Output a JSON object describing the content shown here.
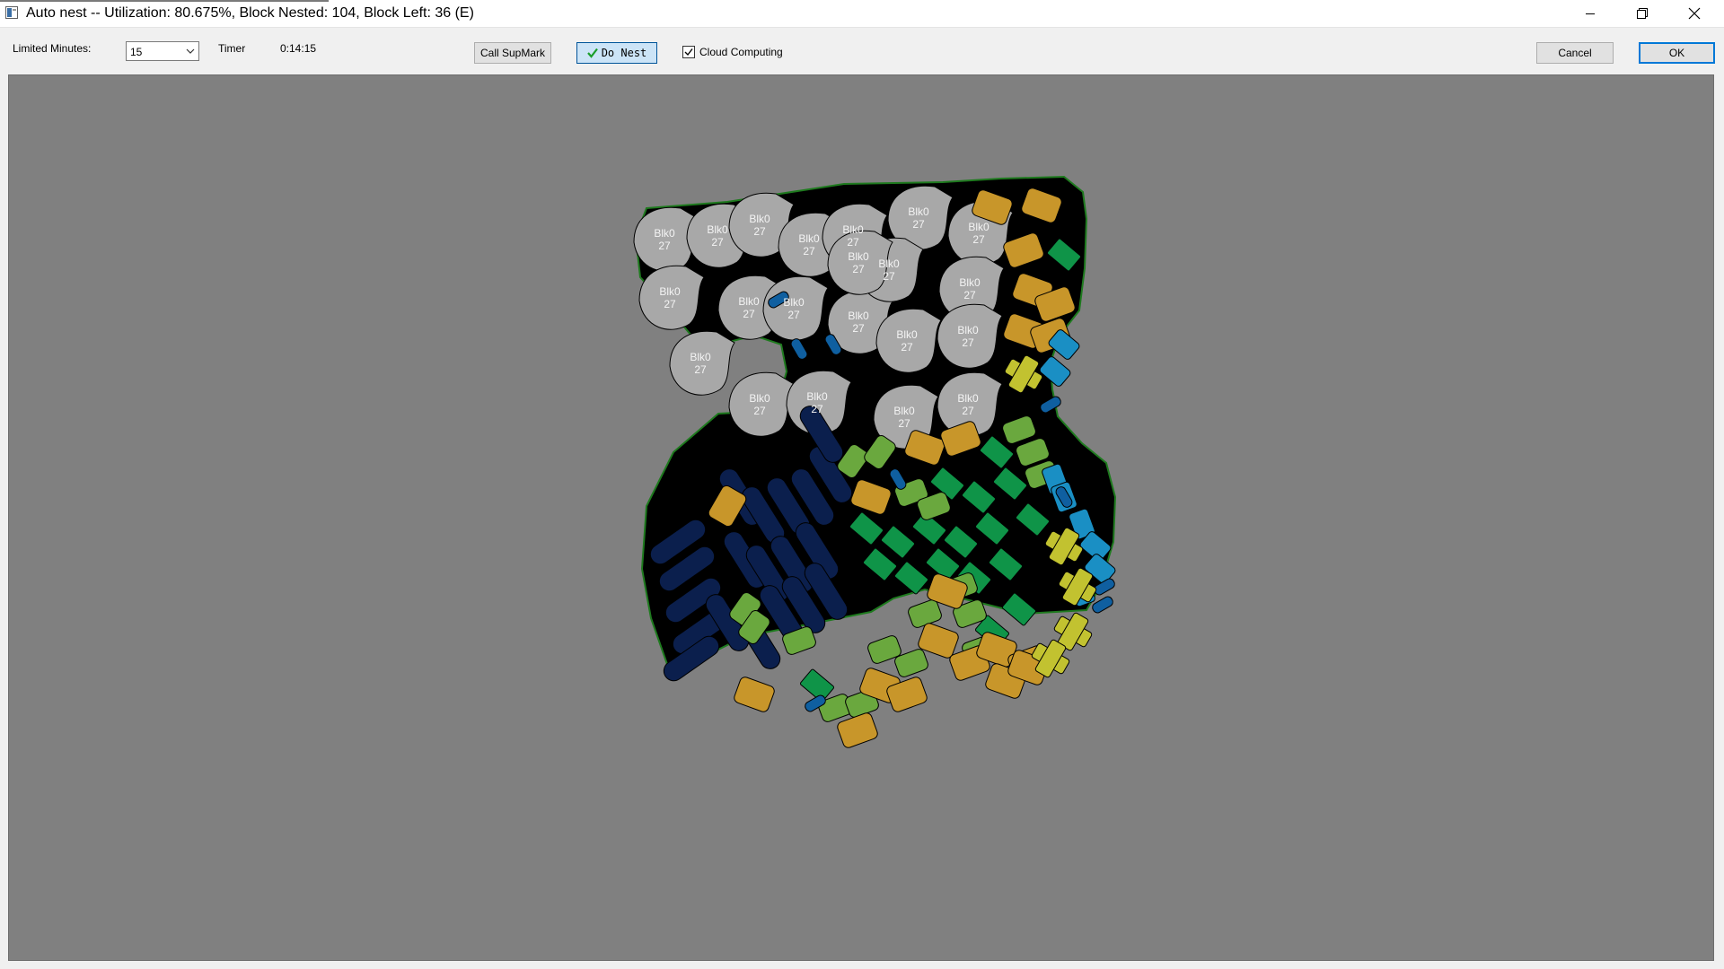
{
  "window": {
    "title": "Auto nest --  Utilization: 80.675%, Block Nested: 104, Block Left: 36  (E)"
  },
  "toolbar": {
    "limited_minutes_label": "Limited Minutes:",
    "limited_minutes_value": "15",
    "timer_label": "Timer",
    "timer_value": "0:14:15",
    "call_supmark_label": "Call SupMark",
    "do_nest_label": "Do Nest",
    "cloud_computing_label": "Cloud Computing",
    "cloud_computing_checked": true,
    "cancel_label": "Cancel",
    "ok_label": "OK"
  },
  "nest": {
    "block_label_line1": "Blk0",
    "block_label_line2": "27",
    "colors": {
      "hide": "#000000",
      "hide_outline": "#1e7a1e",
      "grey_block": "#a8a8a8",
      "gold": "#c8962a",
      "green": "#0f9448",
      "light_green": "#6aa83e",
      "navy": "#0b1f4d",
      "blue": "#1a8fc4",
      "dark_blue": "#0f5fa0",
      "yellow": "#c2c230"
    }
  }
}
